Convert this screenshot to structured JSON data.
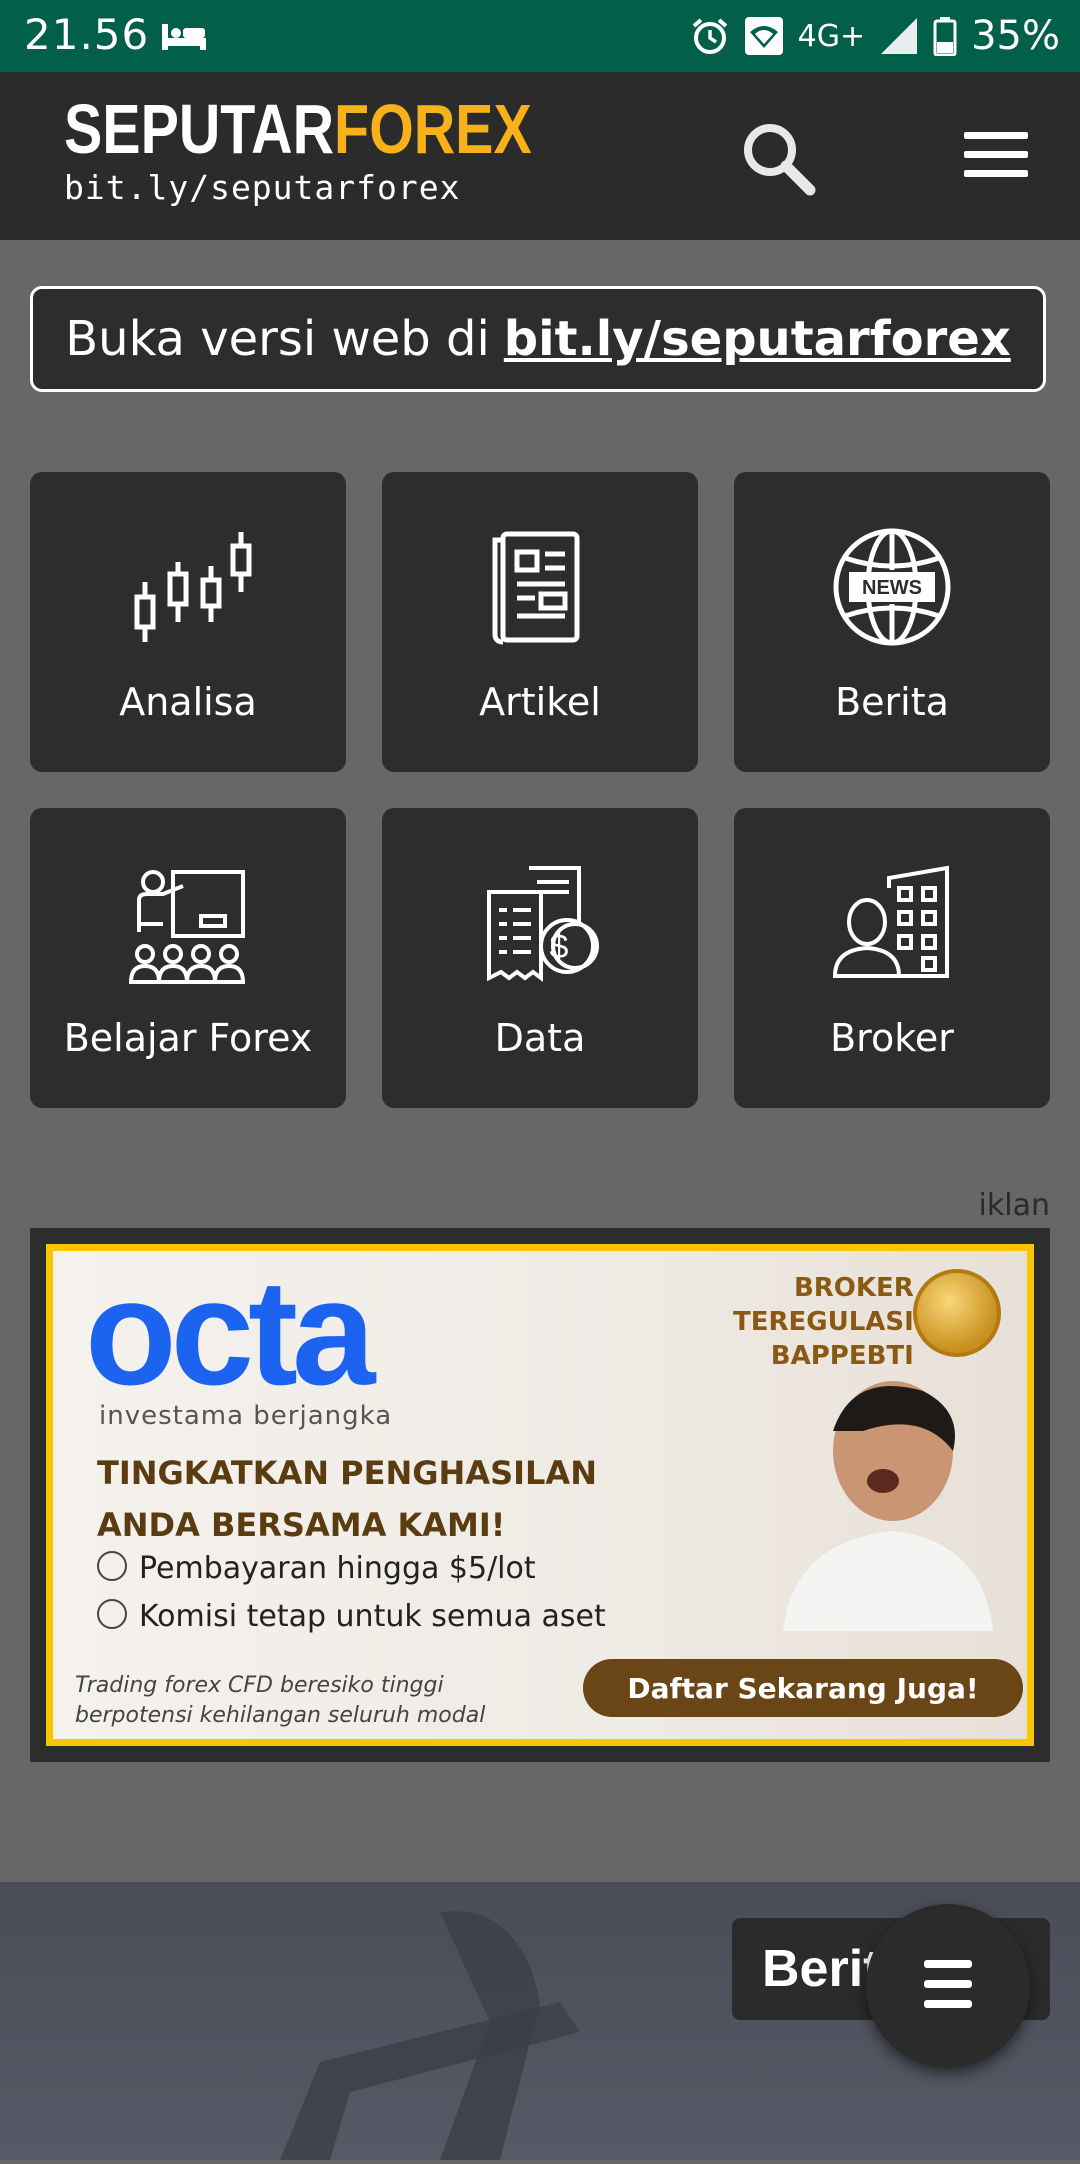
{
  "status_bar": {
    "time": "21.56",
    "network": "4G+",
    "battery": "35%",
    "icons": [
      "sleep-icon",
      "alarm-icon",
      "wifi-icon",
      "signal-icon",
      "battery-icon"
    ]
  },
  "header": {
    "logo_part1": "SEPUTAR",
    "logo_part2": "FOREX",
    "logo_sub": "bit.ly/seputarforex",
    "accent_color": "#f7b21b",
    "icons": [
      "search-icon",
      "menu-icon"
    ]
  },
  "web_banner": {
    "text": "Buka versi web di",
    "link": "bit.ly/seputarforex"
  },
  "tiles": [
    {
      "label": "Analisa",
      "icon": "candlestick-icon"
    },
    {
      "label": "Artikel",
      "icon": "newspaper-icon"
    },
    {
      "label": "Berita",
      "icon": "globe-news-icon"
    },
    {
      "label": "Belajar Forex",
      "icon": "classroom-icon"
    },
    {
      "label": "Data",
      "icon": "receipt-dollar-icon"
    },
    {
      "label": "Broker",
      "icon": "person-building-icon"
    }
  ],
  "ad": {
    "label": "iklan",
    "brand": "octa",
    "brand_sub": "investama berjangka",
    "headline_1": "TINGKATKAN PENGHASILAN",
    "headline_2": "ANDA BERSAMA KAMI!",
    "bullet_1": "Pembayaran hingga $5/lot",
    "bullet_2": "Komisi tetap untuk semua aset",
    "broker_1": "BROKER",
    "broker_2": "TEREGULASI",
    "broker_3": "BAPPEBTI",
    "disclaimer_1": "Trading forex CFD beresiko tinggi",
    "disclaimer_2": "berpotensi kehilangan seluruh modal",
    "cta": "Daftar Sekarang Juga!",
    "brand_color": "#1c63f0"
  },
  "bottom": {
    "tag": "Berita",
    "fab_icon": "menu-icon"
  }
}
